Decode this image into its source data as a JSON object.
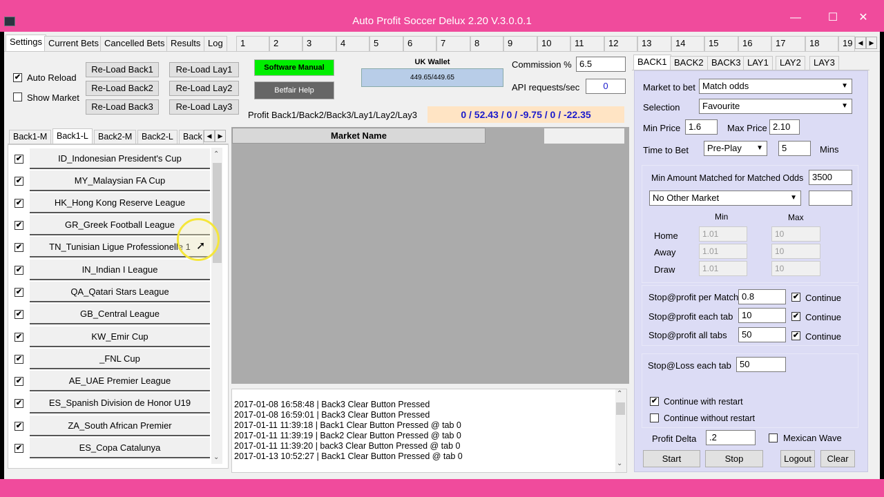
{
  "window": {
    "title": "Auto Profit Soccer Delux 2.20 V.3.0.0.1",
    "min_glyph": "—",
    "max_glyph": "☐",
    "close_glyph": "✕"
  },
  "main_tabs": [
    "Settings",
    "Current Bets",
    "Cancelled Bets",
    "Results",
    "Log",
    "1",
    "2",
    "3",
    "4",
    "5",
    "6",
    "7",
    "8",
    "9",
    "10",
    "11",
    "12",
    "13",
    "14",
    "15",
    "16",
    "17",
    "18",
    "19"
  ],
  "tab_scroll": {
    "left": "◀",
    "right": "▶"
  },
  "top": {
    "auto_reload": "Auto Reload",
    "show_market": "Show Market",
    "reload_back1": "Re-Load Back1",
    "reload_back2": "Re-Load Back2",
    "reload_back3": "Re-Load Back3",
    "reload_lay1": "Re-Load Lay1",
    "reload_lay2": "Re-Load Lay2",
    "reload_lay3": "Re-Load Lay3",
    "software_manual": "Software Manual",
    "betfair_help": "Betfair Help",
    "wallet_label": "UK Wallet",
    "wallet_value": "449.65/449.65",
    "commission_label": "Commission %",
    "commission_value": "6.5",
    "api_label": "API requests/sec",
    "api_value": "0",
    "profit_label": "Profit Back1/Back2/Back3/Lay1/Lay2/Lay3",
    "profit_value": "0 / 52.43 / 0 / -9.75 / 0 / -22.35"
  },
  "sub_tabs": [
    "Back1-M",
    "Back1-L",
    "Back2-M",
    "Back2-L",
    "Back"
  ],
  "leagues": [
    "ID_Indonesian President's Cup",
    "MY_Malaysian FA Cup",
    "HK_Hong Kong Reserve League",
    "GR_Greek Football League",
    "TN_Tunisian Ligue Professionelle 1",
    "IN_Indian I League",
    "QA_Qatari Stars League",
    "GB_Central League",
    "KW_Emir Cup",
    "_FNL Cup",
    "AE_UAE Premier League",
    "ES_Spanish Division de Honor U19",
    "ZA_South African Premier",
    "ES_Copa Catalunya"
  ],
  "market_header": "Market Name",
  "log": [
    "2017-01-08 16:58:48 | Back3 Clear Button Pressed",
    "2017-01-08 16:59:01 | Back3 Clear Button Pressed",
    "2017-01-11 11:39:18 | Back1 Clear Button Pressed @ tab 0",
    "2017-01-11 11:39:19 | Back2 Clear Button Pressed @ tab 0",
    "2017-01-11 11:39:20 | back3 Clear Button Pressed @ tab 0",
    "2017-01-13 10:52:27 | Back1 Clear Button Pressed @ tab 0"
  ],
  "right_tabs": [
    "BACK1",
    "BACK2",
    "BACK3",
    "LAY1",
    "LAY2",
    "LAY3"
  ],
  "settings": {
    "market_to_bet_label": "Market to bet",
    "market_to_bet": "Match odds",
    "selection_label": "Selection",
    "selection": "Favourite",
    "min_price_label": "Min Price",
    "min_price": "1.6",
    "max_price_label": "Max Price",
    "max_price": "2.10",
    "time_to_bet_label": "Time to Bet",
    "time_to_bet": "Pre-Play",
    "mins_value": "5",
    "mins_label": "Mins",
    "min_matched_label": "Min Amount Matched for Matched Odds",
    "min_matched": "3500",
    "other_market": "No Other Market",
    "min_hdr": "Min",
    "max_hdr": "Max",
    "home": "Home",
    "away": "Away",
    "draw": "Draw",
    "odds_min": "1.01",
    "odds_max": "10",
    "stop_profit_match_label": "Stop@profit per Match",
    "stop_profit_match": "0.8",
    "stop_profit_tab_label": "Stop@profit each tab",
    "stop_profit_tab": "10",
    "stop_profit_all_label": "Stop@profit all tabs",
    "stop_profit_all": "50",
    "continue_label": "Continue",
    "stop_loss_label": "Stop@Loss each tab",
    "stop_loss": "50",
    "continue_restart": "Continue with restart",
    "continue_no_restart": "Continue without restart",
    "profit_delta_label": "Profit Delta",
    "profit_delta": ".2",
    "mexican_wave": "Mexican Wave",
    "start": "Start",
    "stop": "Stop",
    "logout": "Logout",
    "clear": "Clear"
  },
  "checkmark": "✔",
  "colors": {
    "titlebar": "#f04b9c",
    "manual_button": "#00ee00",
    "profit_bg": "#ffe4c4",
    "profit_text": "#1a1acc",
    "panel_bg": "#dcdcf5"
  }
}
